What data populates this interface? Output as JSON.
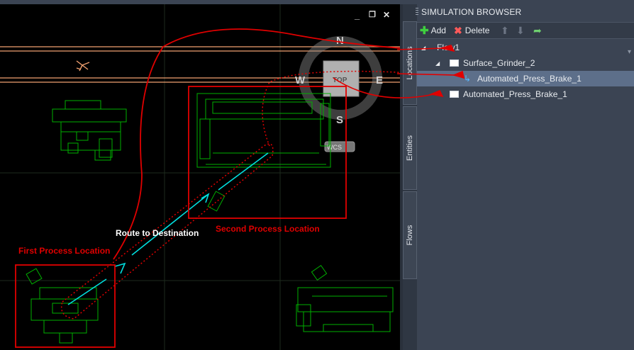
{
  "viewport": {
    "controls": {
      "minimize": "_",
      "restore": "❐",
      "close": "✕"
    },
    "viewcube": {
      "north": "N",
      "south": "S",
      "east": "E",
      "west": "W",
      "face": "TOP",
      "wcs": "WCS"
    },
    "annotations": {
      "route": "Route to Destination",
      "second": "Second Process Location",
      "first": "First Process Location"
    }
  },
  "tabs": [
    "Locations",
    "Entities",
    "Flows"
  ],
  "panel": {
    "title": "SIMULATION BROWSER",
    "toolbar": {
      "add": "Add",
      "delete": "Delete"
    },
    "tree": [
      {
        "label": "Flow1",
        "icon": "expand-icon"
      },
      {
        "label": "Surface_Grinder_2",
        "icon": "location-box-icon"
      },
      {
        "label": "Automated_Press_Brake_1",
        "icon": "route-arrow-icon"
      },
      {
        "label": "Automated_Press_Brake_1",
        "icon": "location-box-icon"
      }
    ]
  },
  "colors": {
    "annotation": "#e00000",
    "route": "#00e0e0",
    "cad": "#00c000",
    "selection": "#5d6f8a"
  }
}
